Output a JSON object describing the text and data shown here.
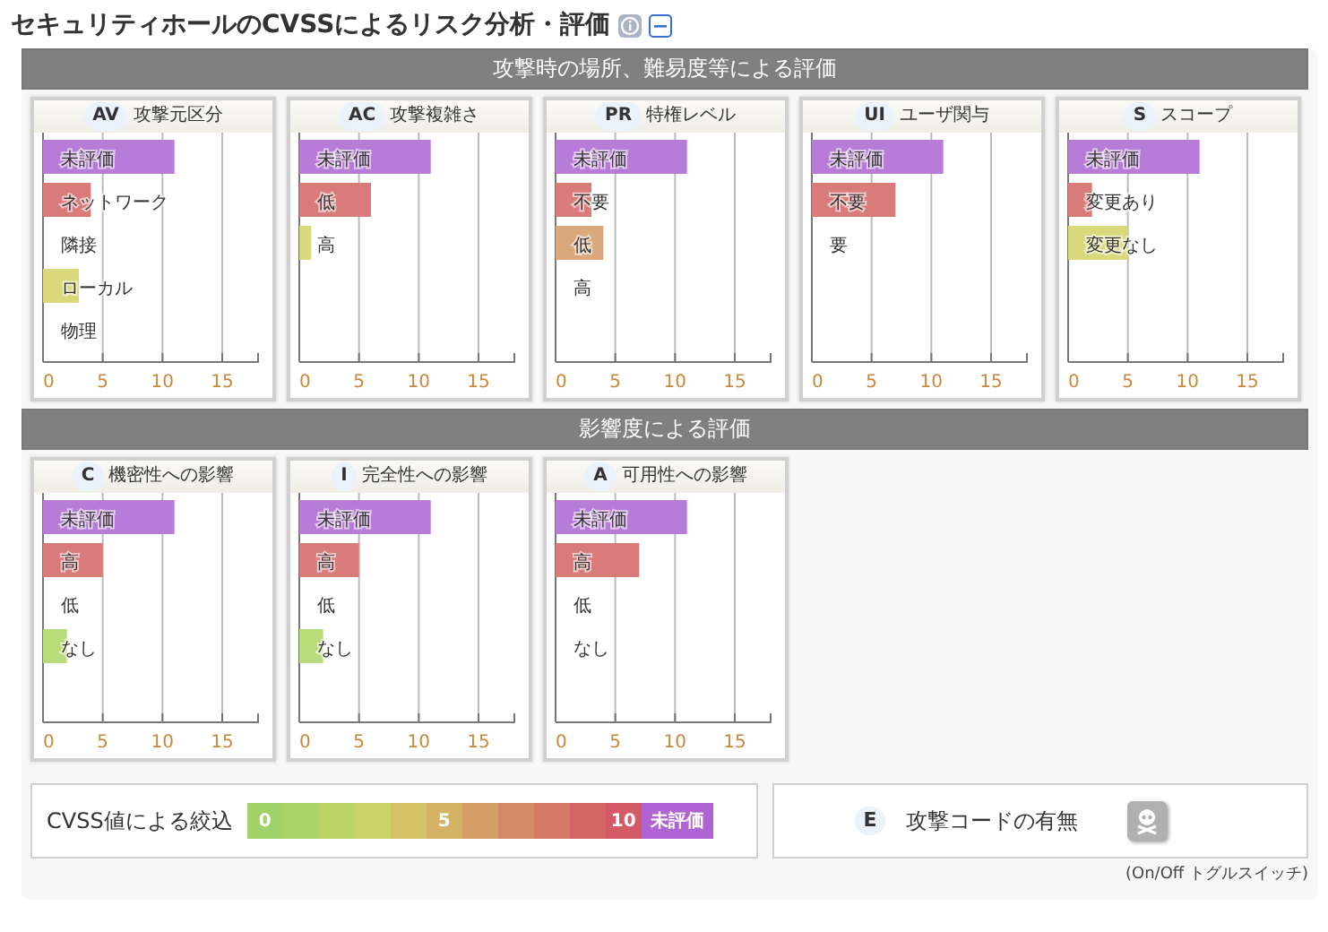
{
  "title": "セキュリティホールのCVSSによるリスク分析・評価",
  "sections": [
    {
      "heading": "攻撃時の場所、難易度等による評価",
      "metrics": [
        {
          "code": "AV",
          "name": "攻撃元区分",
          "chart_data": {
            "type": "bar",
            "orientation": "horizontal",
            "categories": [
              "未評価",
              "ネットワーク",
              "隣接",
              "ローカル",
              "物理"
            ],
            "values": [
              11,
              4,
              0,
              3,
              0
            ],
            "colors": [
              "#b77bd8",
              "#d97b7b",
              null,
              "#d9d97b",
              null
            ],
            "xlim": [
              0,
              18
            ],
            "xticks": [
              0,
              5,
              10,
              15
            ],
            "grid": true
          }
        },
        {
          "code": "AC",
          "name": "攻撃複雑さ",
          "chart_data": {
            "type": "bar",
            "orientation": "horizontal",
            "categories": [
              "未評価",
              "低",
              "高"
            ],
            "values": [
              11,
              6,
              1
            ],
            "colors": [
              "#b77bd8",
              "#d97b7b",
              "#d9d97b"
            ],
            "xlim": [
              0,
              18
            ],
            "xticks": [
              0,
              5,
              10,
              15
            ],
            "grid": true
          }
        },
        {
          "code": "PR",
          "name": "特権レベル",
          "chart_data": {
            "type": "bar",
            "orientation": "horizontal",
            "categories": [
              "未評価",
              "不要",
              "低",
              "高"
            ],
            "values": [
              11,
              3,
              4,
              0
            ],
            "colors": [
              "#b77bd8",
              "#d97b7b",
              "#d9a87b",
              null
            ],
            "xlim": [
              0,
              18
            ],
            "xticks": [
              0,
              5,
              10,
              15
            ],
            "grid": true
          }
        },
        {
          "code": "UI",
          "name": "ユーザ関与",
          "chart_data": {
            "type": "bar",
            "orientation": "horizontal",
            "categories": [
              "未評価",
              "不要",
              "要"
            ],
            "values": [
              11,
              7,
              0
            ],
            "colors": [
              "#b77bd8",
              "#d97b7b",
              null
            ],
            "xlim": [
              0,
              18
            ],
            "xticks": [
              0,
              5,
              10,
              15
            ],
            "grid": true
          }
        },
        {
          "code": "S",
          "name": "スコープ",
          "chart_data": {
            "type": "bar",
            "orientation": "horizontal",
            "categories": [
              "未評価",
              "変更あり",
              "変更なし"
            ],
            "values": [
              11,
              2,
              5
            ],
            "colors": [
              "#b77bd8",
              "#d97b7b",
              "#d9d97b"
            ],
            "xlim": [
              0,
              18
            ],
            "xticks": [
              0,
              5,
              10,
              15
            ],
            "grid": true
          }
        }
      ]
    },
    {
      "heading": "影響度による評価",
      "metrics": [
        {
          "code": "C",
          "name": "機密性への影響",
          "chart_data": {
            "type": "bar",
            "orientation": "horizontal",
            "categories": [
              "未評価",
              "高",
              "低",
              "なし"
            ],
            "values": [
              11,
              5,
              0,
              2
            ],
            "colors": [
              "#b77bd8",
              "#d97b7b",
              null,
              "#b9dc7b"
            ],
            "xlim": [
              0,
              18
            ],
            "xticks": [
              0,
              5,
              10,
              15
            ],
            "grid": true
          }
        },
        {
          "code": "I",
          "name": "完全性への影響",
          "chart_data": {
            "type": "bar",
            "orientation": "horizontal",
            "categories": [
              "未評価",
              "高",
              "低",
              "なし"
            ],
            "values": [
              11,
              5,
              0,
              2
            ],
            "colors": [
              "#b77bd8",
              "#d97b7b",
              null,
              "#b9dc7b"
            ],
            "xlim": [
              0,
              18
            ],
            "xticks": [
              0,
              5,
              10,
              15
            ],
            "grid": true
          }
        },
        {
          "code": "A",
          "name": "可用性への影響",
          "chart_data": {
            "type": "bar",
            "orientation": "horizontal",
            "categories": [
              "未評価",
              "高",
              "低",
              "なし"
            ],
            "values": [
              11,
              7,
              0,
              0
            ],
            "colors": [
              "#b77bd8",
              "#d97b7b",
              null,
              null
            ],
            "xlim": [
              0,
              18
            ],
            "xticks": [
              0,
              5,
              10,
              15
            ],
            "grid": true
          }
        }
      ]
    }
  ],
  "filter": {
    "label": "CVSS値による絞込",
    "scale": [
      {
        "label": "0",
        "color": "#9fd36a"
      },
      {
        "color": "#aad468"
      },
      {
        "color": "#bad466"
      },
      {
        "color": "#cad466"
      },
      {
        "color": "#d2c466"
      },
      {
        "label": "5",
        "color": "#d4b266"
      },
      {
        "color": "#d49e66"
      },
      {
        "color": "#d48a66"
      },
      {
        "color": "#d47a66"
      },
      {
        "color": "#d46666"
      },
      {
        "label": "10",
        "color": "#d45a66"
      },
      {
        "label": "未評価",
        "color": "#b063d2"
      }
    ]
  },
  "exploit": {
    "code": "E",
    "label": "攻撃コードの有無",
    "on": false
  },
  "note": "(On/Off トグルスイッチ)"
}
